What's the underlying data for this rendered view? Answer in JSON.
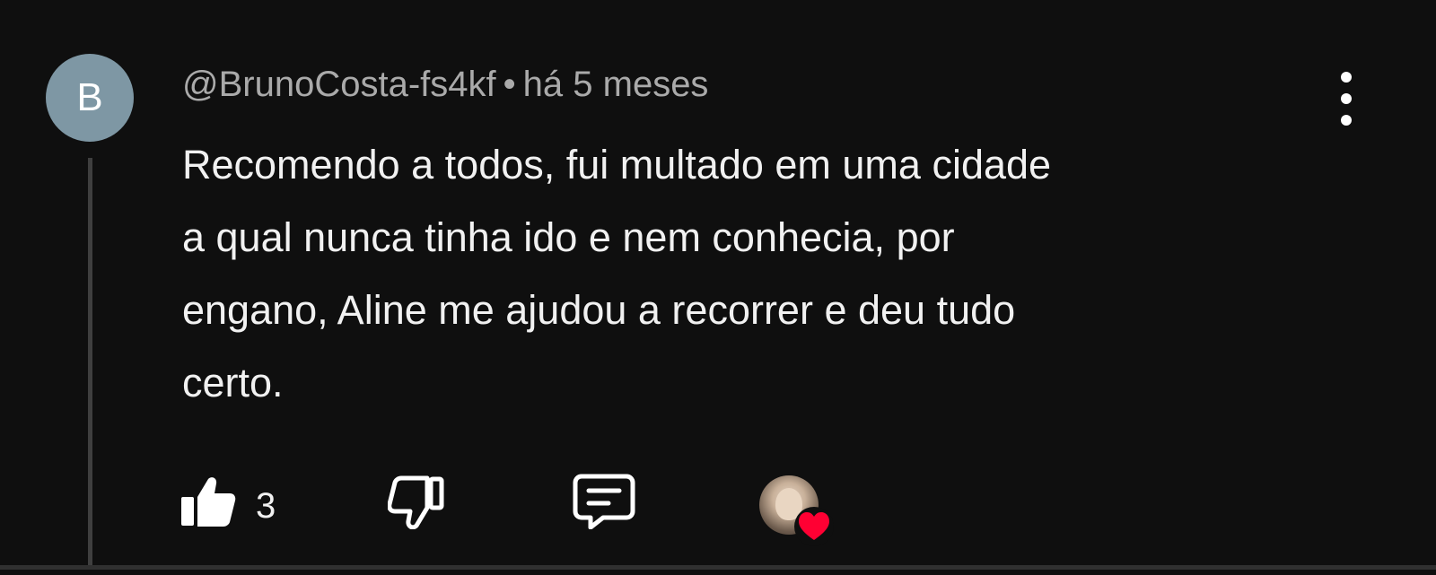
{
  "comment": {
    "avatar_letter": "B",
    "author": "@BrunoCosta-fs4kf",
    "separator": "•",
    "timestamp": "há 5 meses",
    "text_lines": [
      "Recomendo a todos, fui multado em uma cidade",
      "a qual nunca tinha ido e nem conhecia, por",
      "engano, Aline me ajudou a recorrer e deu tudo",
      "certo."
    ],
    "like_count": "3"
  },
  "icons": {
    "more": "more-vert-icon",
    "like": "thumbs-up-icon",
    "dislike": "thumbs-down-icon",
    "reply": "reply-comment-icon",
    "creator_heart": "heart-icon"
  },
  "colors": {
    "background": "#0f0f0f",
    "avatar_bg": "#7e97a4",
    "heart": "#ff0033",
    "secondary_text": "#aaaaaa",
    "primary_text": "#f1f1f1"
  }
}
